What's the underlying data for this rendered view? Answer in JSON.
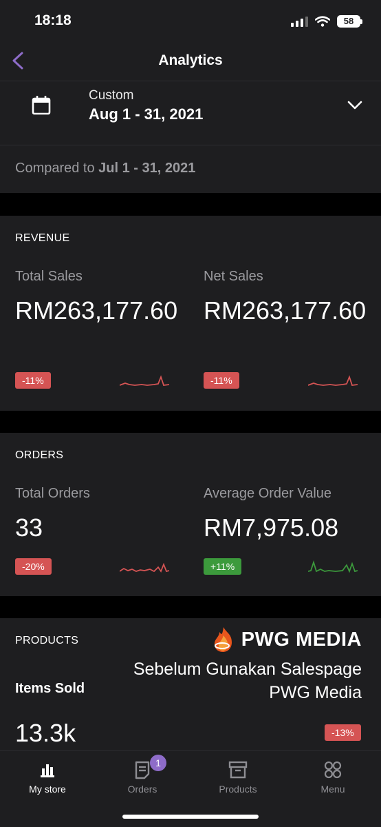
{
  "status_bar": {
    "time": "18:18",
    "battery": "58"
  },
  "header": {
    "title": "Analytics"
  },
  "date_filter": {
    "label": "Custom",
    "range": "Aug 1 - 31, 2021",
    "compare_prefix": "Compared to ",
    "compare_range": "Jul 1 - 31, 2021"
  },
  "revenue": {
    "heading": "REVENUE",
    "total_sales": {
      "label": "Total Sales",
      "value": "RM263,177.60",
      "change": "-11%"
    },
    "net_sales": {
      "label": "Net Sales",
      "value": "RM263,177.60",
      "change": "-11%"
    }
  },
  "orders": {
    "heading": "ORDERS",
    "total_orders": {
      "label": "Total Orders",
      "value": "33",
      "change": "-20%"
    },
    "average_order_value": {
      "label": "Average Order Value",
      "value": "RM7,975.08",
      "change": "+11%"
    }
  },
  "products": {
    "heading": "PRODUCTS",
    "items_sold": {
      "label": "Items Sold",
      "value": "13.3k",
      "change": "-13%"
    }
  },
  "overlay": {
    "brand": "PWG MEDIA",
    "line1": "Sebelum Gunakan Salespage",
    "line2": "PWG Media"
  },
  "tab_bar": {
    "tabs": [
      {
        "label": "My store",
        "icon": "bar-chart-icon",
        "active": true
      },
      {
        "label": "Orders",
        "icon": "orders-doc-icon",
        "badge": "1"
      },
      {
        "label": "Products",
        "icon": "archive-box-icon"
      },
      {
        "label": "Menu",
        "icon": "grid-circles-icon"
      }
    ]
  },
  "colors": {
    "background": "#1e1e20",
    "separator": "#000000",
    "accent_purple": "#8e6cc9",
    "negative": "#d55454",
    "positive": "#3c9a3c",
    "muted_text": "#9b9b9f"
  }
}
